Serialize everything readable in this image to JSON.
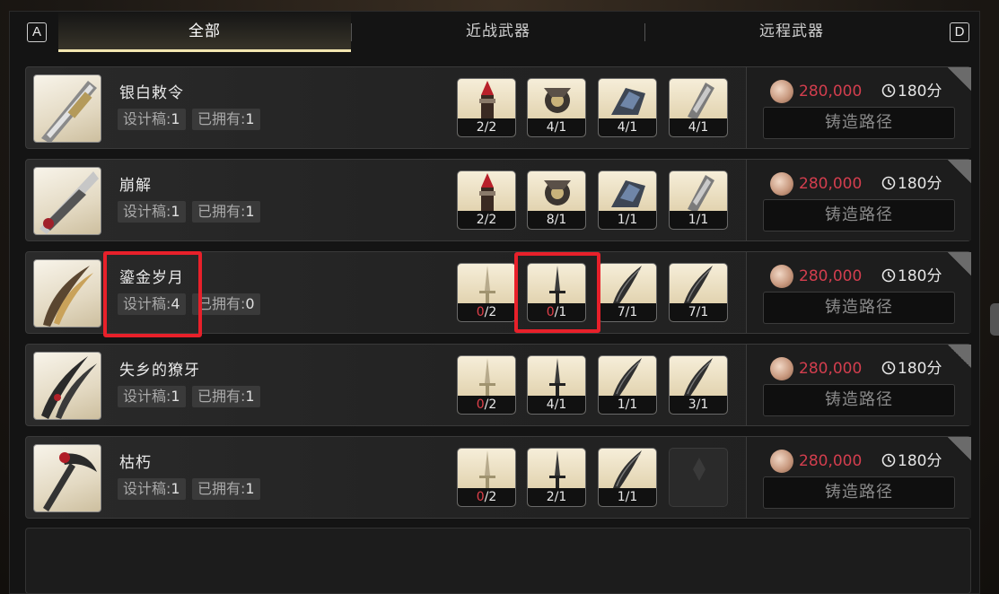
{
  "tabs": {
    "key_left": "A",
    "key_right": "D",
    "items": [
      {
        "label": "全部",
        "active": true
      },
      {
        "label": "近战武器",
        "active": false
      },
      {
        "label": "远程武器",
        "active": false
      }
    ]
  },
  "labels": {
    "design_label": "设计稿:",
    "owned_label": "已拥有:",
    "path_button": "铸造路径"
  },
  "weapons": [
    {
      "name": "银白敕令",
      "design": "1",
      "owned": "1",
      "materials": [
        {
          "have": "2",
          "need": "2",
          "icon": "red-crystal-icon"
        },
        {
          "have": "4",
          "need": "1",
          "icon": "ornate-part-icon"
        },
        {
          "have": "4",
          "need": "1",
          "icon": "blue-part-icon"
        },
        {
          "have": "4",
          "need": "1",
          "icon": "mechanism-icon"
        }
      ],
      "price": "280,000",
      "time": "180分"
    },
    {
      "name": "崩解",
      "design": "1",
      "owned": "1",
      "materials": [
        {
          "have": "2",
          "need": "2",
          "icon": "red-crystal-icon"
        },
        {
          "have": "8",
          "need": "1",
          "icon": "ornate-part-icon"
        },
        {
          "have": "1",
          "need": "1",
          "icon": "blue-part-icon"
        },
        {
          "have": "1",
          "need": "1",
          "icon": "mechanism-icon"
        }
      ],
      "price": "280,000",
      "time": "180分"
    },
    {
      "name": "鎏金岁月",
      "design": "4",
      "owned": "0",
      "materials": [
        {
          "have": "0",
          "need": "2",
          "icon": "sword-sketch-icon",
          "lack": true
        },
        {
          "have": "0",
          "need": "1",
          "icon": "sword-icon",
          "lack": true
        },
        {
          "have": "7",
          "need": "1",
          "icon": "curved-blade-icon"
        },
        {
          "have": "7",
          "need": "1",
          "icon": "curved-blade-icon"
        }
      ],
      "price": "280,000",
      "time": "180分"
    },
    {
      "name": "失乡的獠牙",
      "design": "1",
      "owned": "1",
      "materials": [
        {
          "have": "0",
          "need": "2",
          "icon": "sword-sketch-icon",
          "lack": true
        },
        {
          "have": "4",
          "need": "1",
          "icon": "sword-icon"
        },
        {
          "have": "1",
          "need": "1",
          "icon": "curved-blade-icon"
        },
        {
          "have": "3",
          "need": "1",
          "icon": "curved-blade-icon"
        }
      ],
      "price": "280,000",
      "time": "180分"
    },
    {
      "name": "枯朽",
      "design": "1",
      "owned": "1",
      "materials": [
        {
          "have": "0",
          "need": "2",
          "icon": "sword-sketch-icon",
          "lack": true
        },
        {
          "have": "2",
          "need": "1",
          "icon": "sword-icon"
        },
        {
          "have": "1",
          "need": "1",
          "icon": "curved-blade-icon"
        },
        {
          "empty": true,
          "icon": "empty-slot-icon"
        }
      ],
      "price": "280,000",
      "time": "180分"
    }
  ]
}
